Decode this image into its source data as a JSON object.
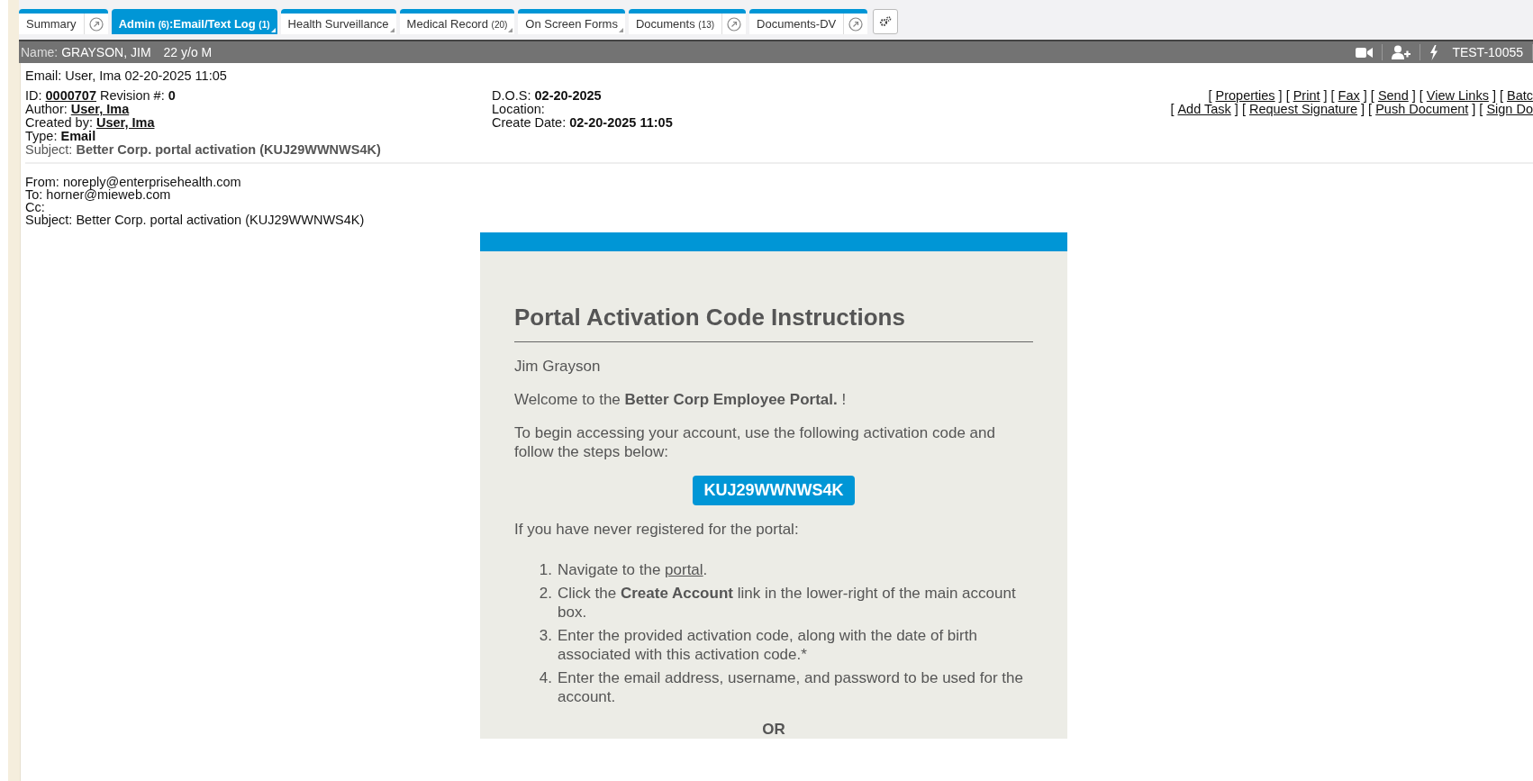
{
  "tabs": [
    {
      "parts": [
        {
          "text": "Summary",
          "kind": "label"
        }
      ],
      "selected": false,
      "popout": true,
      "menu": false
    },
    {
      "parts": [
        {
          "text": "Admin ",
          "kind": "label"
        },
        {
          "text": "(6)",
          "kind": "count"
        },
        {
          "text": ":Email/Text Log ",
          "kind": "label"
        },
        {
          "text": "(1)",
          "kind": "count"
        }
      ],
      "selected": true,
      "popout": false,
      "menu": true
    },
    {
      "parts": [
        {
          "text": "Health Surveillance",
          "kind": "label"
        }
      ],
      "selected": false,
      "popout": false,
      "menu": true
    },
    {
      "parts": [
        {
          "text": "Medical Record ",
          "kind": "label"
        },
        {
          "text": "(20)",
          "kind": "count"
        }
      ],
      "selected": false,
      "popout": false,
      "menu": true
    },
    {
      "parts": [
        {
          "text": "On Screen Forms",
          "kind": "label"
        }
      ],
      "selected": false,
      "popout": false,
      "menu": true
    },
    {
      "parts": [
        {
          "text": "Documents ",
          "kind": "label"
        },
        {
          "text": "(13)",
          "kind": "count"
        }
      ],
      "selected": false,
      "popout": true,
      "menu": false
    },
    {
      "parts": [
        {
          "text": "Documents-DV",
          "kind": "label"
        }
      ],
      "selected": false,
      "popout": true,
      "menu": false
    }
  ],
  "patient_bar": {
    "name_label": "Name:",
    "name": "GRAYSON, JIM",
    "age_sex": "22 y/o M",
    "record_id": "TEST-10055"
  },
  "document_title": "Email: User, Ima 02-20-2025 11:05",
  "info_left": [
    {
      "muted": false,
      "segments": [
        {
          "text": "ID:",
          "kind": "label"
        },
        {
          "text": "0000707",
          "kind": "link"
        },
        {
          "text": "Revision #:",
          "kind": "label"
        },
        {
          "text": "0",
          "kind": "value"
        }
      ]
    },
    {
      "muted": false,
      "segments": [
        {
          "text": "Author:",
          "kind": "label"
        },
        {
          "text": "User, Ima",
          "kind": "link"
        }
      ]
    },
    {
      "muted": false,
      "segments": [
        {
          "text": "Created by:",
          "kind": "label"
        },
        {
          "text": "User, Ima",
          "kind": "link"
        }
      ]
    },
    {
      "muted": false,
      "segments": [
        {
          "text": "Type:",
          "kind": "label"
        },
        {
          "text": "Email",
          "kind": "value"
        }
      ]
    },
    {
      "muted": true,
      "segments": [
        {
          "text": "Subject:",
          "kind": "label"
        },
        {
          "text": "Better Corp. portal activation (KUJ29WWNWS4K)",
          "kind": "value"
        }
      ]
    }
  ],
  "info_middle": [
    {
      "muted": false,
      "segments": [
        {
          "text": "D.O.S:",
          "kind": "label"
        },
        {
          "text": "02-20-2025",
          "kind": "value"
        }
      ]
    },
    {
      "muted": false,
      "segments": [
        {
          "text": "Location:",
          "kind": "label"
        }
      ]
    },
    {
      "muted": false,
      "segments": [
        {
          "text": "Create Date:",
          "kind": "label"
        },
        {
          "text": "02-20-2025 11:05",
          "kind": "value"
        }
      ]
    }
  ],
  "actions": [
    [
      {
        "text": "[",
        "kind": "bracket"
      },
      {
        "text": "Properties",
        "kind": "link"
      },
      {
        "text": "] [",
        "kind": "bracket"
      },
      {
        "text": "Print",
        "kind": "link"
      },
      {
        "text": "] [",
        "kind": "bracket"
      },
      {
        "text": "Fax",
        "kind": "link"
      },
      {
        "text": "] [",
        "kind": "bracket"
      },
      {
        "text": "Send",
        "kind": "link"
      },
      {
        "text": "] [",
        "kind": "bracket"
      },
      {
        "text": "View Links",
        "kind": "link"
      },
      {
        "text": "] [",
        "kind": "bracket"
      },
      {
        "text": "Batc",
        "kind": "link"
      }
    ],
    [
      {
        "text": "[",
        "kind": "bracket"
      },
      {
        "text": "Add Task",
        "kind": "link"
      },
      {
        "text": "] [",
        "kind": "bracket"
      },
      {
        "text": "Request Signature",
        "kind": "link"
      },
      {
        "text": "] [",
        "kind": "bracket"
      },
      {
        "text": "Push Document",
        "kind": "link"
      },
      {
        "text": "] [",
        "kind": "bracket"
      },
      {
        "text": "Sign Do",
        "kind": "link"
      }
    ]
  ],
  "email_headers": [
    "From: noreply@enterprisehealth.com",
    "To: horner@mieweb.com",
    "Cc:",
    "Subject: Better Corp. portal activation (KUJ29WWNWS4K)"
  ],
  "email_body": {
    "heading": "Portal Activation Code Instructions",
    "greeting": "Jim Grayson",
    "welcome": "Welcome to the **Better Corp Employee Portal.** !",
    "intro": "To begin accessing your account, use the following activation code and follow the steps below:",
    "code": "KUJ29WWNWS4K",
    "never_registered": "If you have never registered for the portal:",
    "steps": [
      {
        "number": "1.",
        "segments": [
          {
            "text": "Navigate to the ",
            "kind": "text"
          },
          {
            "text": "portal",
            "kind": "link"
          },
          {
            "text": ".",
            "kind": "text"
          }
        ]
      },
      {
        "number": "2.",
        "segments": [
          {
            "text": "Click the **Create Account** link in the lower-right of the main account box.",
            "kind": "text"
          }
        ]
      },
      {
        "number": "3.",
        "segments": [
          {
            "text": "Enter the provided activation code, along with the date of birth associated with this activation code.*",
            "kind": "text"
          }
        ]
      },
      {
        "number": "4.",
        "segments": [
          {
            "text": "Enter the email address, username, and password to be used for the account.",
            "kind": "text"
          }
        ]
      }
    ],
    "separator": "OR"
  }
}
